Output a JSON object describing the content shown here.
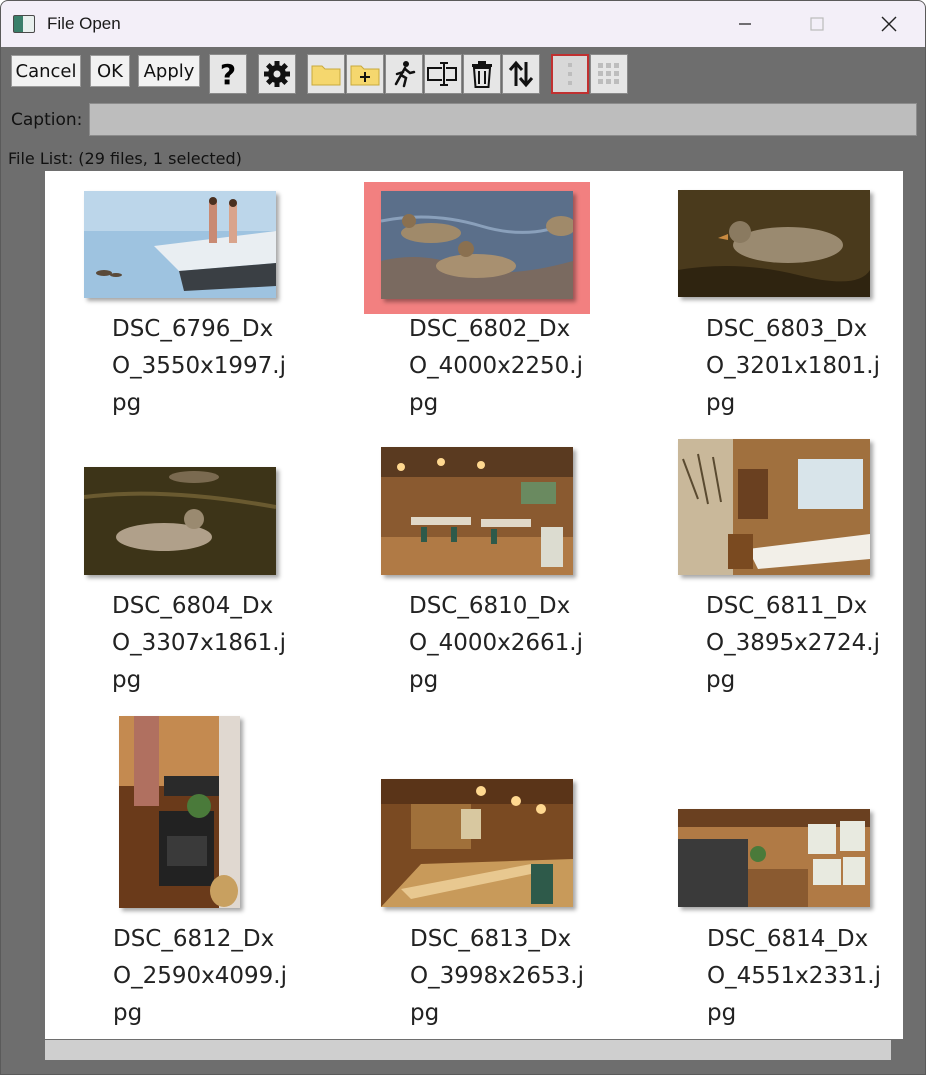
{
  "window": {
    "title": "File Open"
  },
  "toolbar": {
    "cancel_label": "Cancel",
    "ok_label": "OK",
    "apply_label": "Apply",
    "help_label": "?"
  },
  "caption": {
    "label": "Caption:",
    "value": ""
  },
  "file_list": {
    "label": "File List: (29 files, 1 selected)",
    "files": [
      {
        "name": "DSC_6796_Dx\nO_3550x1997.j\npg",
        "selected": false,
        "scene": "dock"
      },
      {
        "name": "DSC_6802_Dx\nO_4000x2250.j\npg",
        "selected": true,
        "scene": "ducks"
      },
      {
        "name": "DSC_6803_Dx\nO_3201x1801.j\npg",
        "selected": false,
        "scene": "duck"
      },
      {
        "name": "DSC_6804_Dx\nO_3307x1861.j\npg",
        "selected": false,
        "scene": "duck-dark"
      },
      {
        "name": "DSC_6810_Dx\nO_4000x2661.j\npg",
        "selected": false,
        "scene": "restaurant"
      },
      {
        "name": "DSC_6811_Dx\nO_3895x2724.j\npg",
        "selected": false,
        "scene": "dining"
      },
      {
        "name": "DSC_6812_Dx\nO_2590x4099.j\npg",
        "selected": false,
        "scene": "stove"
      },
      {
        "name": "DSC_6813_Dx\nO_3998x2653.j\npg",
        "selected": false,
        "scene": "bar"
      },
      {
        "name": "DSC_6814_Dx\nO_4551x2331.j\npg",
        "selected": false,
        "scene": "kitchen"
      }
    ]
  },
  "colors": {
    "selection": "#f28080",
    "toolbar_selected_border": "#c03030",
    "folder": "#f5d76e"
  }
}
